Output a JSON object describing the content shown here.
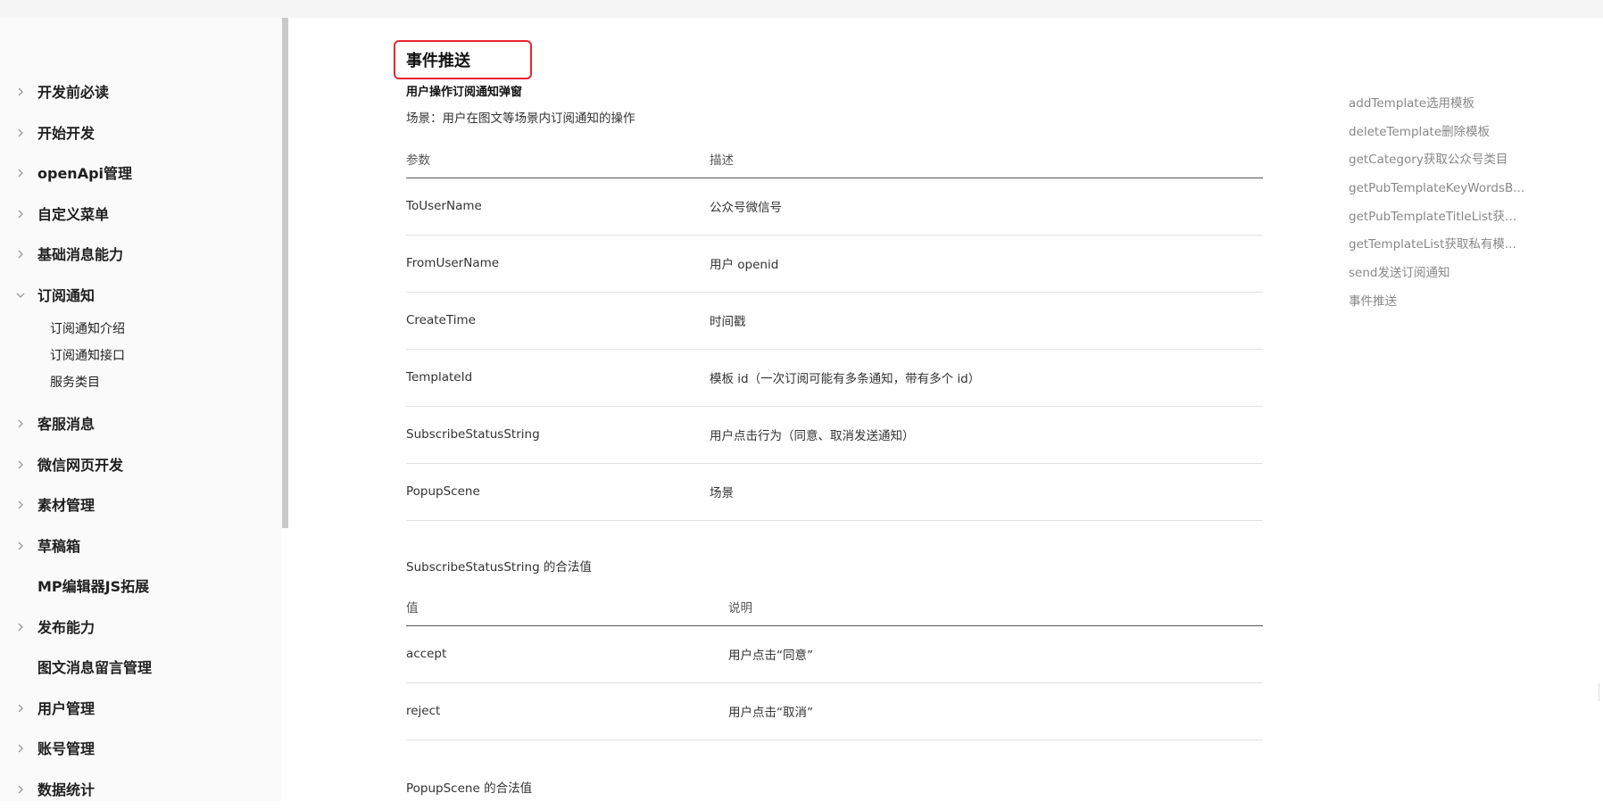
{
  "sidebar": {
    "items": [
      {
        "label": "开发前必读",
        "has_children": true
      },
      {
        "label": "开始开发",
        "has_children": true
      },
      {
        "label": "openApi管理",
        "has_children": true
      },
      {
        "label": "自定义菜单",
        "has_children": true
      },
      {
        "label": "基础消息能力",
        "has_children": true
      },
      {
        "label": "订阅通知",
        "has_children": true,
        "expanded": true,
        "children": [
          "订阅通知介绍",
          "订阅通知接口",
          "服务类目"
        ]
      },
      {
        "label": "客服消息",
        "has_children": true
      },
      {
        "label": "微信网页开发",
        "has_children": true
      },
      {
        "label": "素材管理",
        "has_children": true
      },
      {
        "label": "草稿箱",
        "has_children": true
      },
      {
        "label": "MP编辑器JS拓展",
        "has_children": false
      },
      {
        "label": "发布能力",
        "has_children": true
      },
      {
        "label": "图文消息留言管理",
        "has_children": false
      },
      {
        "label": "用户管理",
        "has_children": true
      },
      {
        "label": "账号管理",
        "has_children": true
      },
      {
        "label": "数据统计",
        "has_children": true
      }
    ]
  },
  "content": {
    "title": "事件推送",
    "subtitle": "用户操作订阅通知弹窗",
    "scene": "场景：用户在图文等场景内订阅通知的操作",
    "params_table": {
      "headers": [
        "参数",
        "描述"
      ],
      "rows": [
        [
          "ToUserName",
          "公众号微信号"
        ],
        [
          "FromUserName",
          "用户 openid"
        ],
        [
          "CreateTime",
          "时间戳"
        ],
        [
          "TemplateId",
          "模板 id（一次订阅可能有多条通知，带有多个 id）"
        ],
        [
          "SubscribeStatusString",
          "用户点击行为（同意、取消发送通知）"
        ],
        [
          "PopupScene",
          "场景"
        ]
      ]
    },
    "status_caption": "SubscribeStatusString 的合法值",
    "status_table": {
      "headers": [
        "值",
        "说明"
      ],
      "rows": [
        [
          "accept",
          "用户点击“同意”"
        ],
        [
          "reject",
          "用户点击“取消”"
        ]
      ]
    },
    "popup_caption": "PopupScene 的合法值"
  },
  "toc": {
    "items": [
      "addTemplate选用模板",
      "deleteTemplate删除模板",
      "getCategory获取公众号类目",
      "getPubTemplateKeyWordsB...",
      "getPubTemplateTitleList获取...",
      "getTemplateList获取私有模...",
      "send发送订阅通知",
      "事件推送"
    ]
  },
  "colors": {
    "highlight_border": "#e8232e",
    "sidebar_bg": "#fafafa",
    "toc_text": "#888888"
  }
}
